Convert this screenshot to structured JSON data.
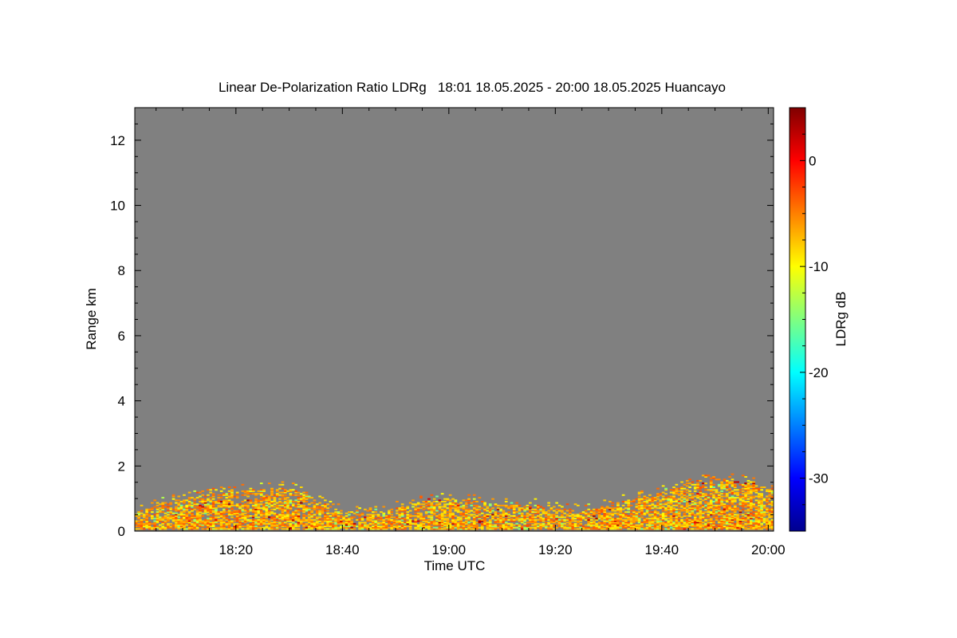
{
  "chart_data": {
    "type": "heatmap",
    "title": "Linear De-Polarization Ratio LDRg   18:01 18.05.2025 - 20:00 18.05.2025 Huancayo",
    "xlabel": "Time UTC",
    "ylabel": "Range km",
    "colorbar_label": "LDRg dB",
    "xlim": [
      "18:01",
      "20:01"
    ],
    "ylim": [
      0,
      13
    ],
    "x_ticks": [
      "18:20",
      "18:40",
      "19:00",
      "19:20",
      "19:40",
      "20:00"
    ],
    "y_ticks": [
      "0",
      "2",
      "4",
      "6",
      "8",
      "10",
      "12"
    ],
    "colorbar_range": [
      -35,
      5
    ],
    "colorbar_ticks": [
      "0",
      "-10",
      "-20",
      "-30"
    ],
    "no_signal_color": "#808080",
    "colormap": "jet",
    "signal_layer": {
      "description_values": "approximate top of the backscatter layer in km vs time",
      "times": [
        "18:01",
        "18:05",
        "18:10",
        "18:15",
        "18:20",
        "18:25",
        "18:30",
        "18:35",
        "18:40",
        "18:45",
        "18:50",
        "18:55",
        "19:00",
        "19:05",
        "19:10",
        "19:15",
        "19:20",
        "19:25",
        "19:30",
        "19:35",
        "19:40",
        "19:45",
        "19:50",
        "19:55",
        "20:00"
      ],
      "top_km": [
        0.6,
        0.8,
        1.0,
        1.1,
        1.2,
        1.3,
        1.3,
        0.9,
        0.6,
        0.5,
        0.7,
        0.9,
        1.0,
        0.9,
        0.8,
        0.8,
        0.7,
        0.6,
        0.8,
        1.0,
        1.2,
        1.4,
        1.6,
        1.5,
        1.3
      ],
      "typical_ldr_db": [
        -10,
        -3
      ]
    }
  }
}
